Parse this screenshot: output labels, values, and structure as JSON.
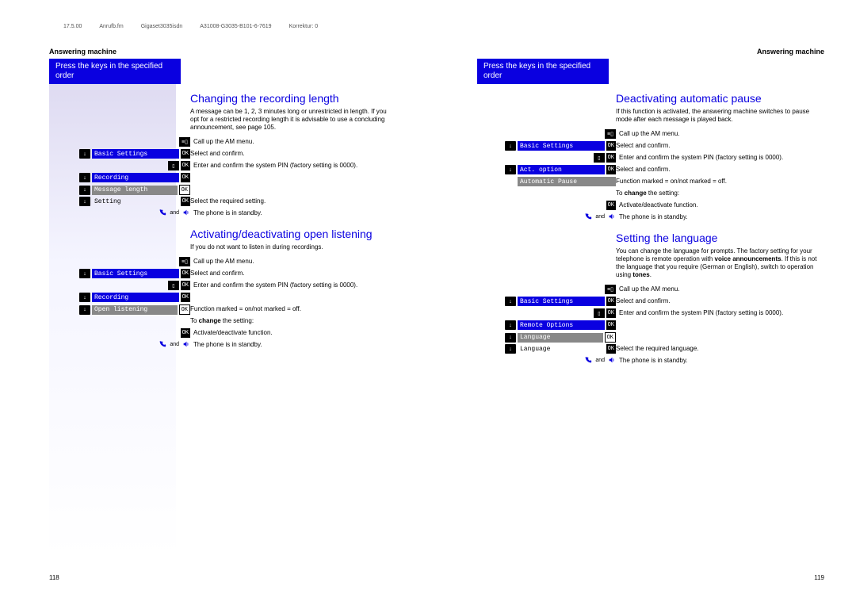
{
  "header": {
    "date": "17.5.00",
    "file": "Anrufb.fm",
    "product": "Gigaset3035isdn",
    "partno": "A31008-G3035-B101-6-7619",
    "korr": "Korrektur: 0"
  },
  "section_title": "Answering machine",
  "blue_bar": "Press the keys in the specified order",
  "left": {
    "h2a": "Changing the recording length",
    "intro_a": "A message can be 1, 2, 3 minutes long or unrestricted in length. If you opt for a restricted recording length it is advisable to use a concluding announcement, see page 105.",
    "rows_a": [
      {
        "k": "menuicon",
        "d": "Call up the AM menu."
      },
      {
        "k": "down",
        "pill": "Basic Settings",
        "ok": "OK",
        "d": "Select and confirm."
      },
      {
        "k": "pin",
        "ok": "OK",
        "d": "Enter and confirm the system PIN (factory setting is 0000)."
      },
      {
        "k": "down",
        "pill": "Recording",
        "ok": "OK",
        "d": ""
      },
      {
        "k": "down",
        "pillg": "Message length",
        "okw": "OK",
        "d": ""
      },
      {
        "k": "down",
        "plain": "Setting",
        "ok": "OK",
        "d": "Select the required setting."
      },
      {
        "k": "handset",
        "d": "The phone is in standby."
      }
    ],
    "h2b": "Activating/deactivating open listening",
    "intro_b": "If you do not want to listen in during recordings.",
    "rows_b": [
      {
        "k": "menuicon",
        "d": "Call up the AM menu."
      },
      {
        "k": "down",
        "pill": "Basic Settings",
        "ok": "OK",
        "d": "Select and confirm."
      },
      {
        "k": "pin",
        "ok": "OK",
        "d": "Enter and confirm the system PIN (factory setting is 0000)."
      },
      {
        "k": "down",
        "pill": "Recording",
        "ok": "OK",
        "d": ""
      },
      {
        "k": "down",
        "pillg": "Open listening",
        "okw": "",
        "d": "Function marked = on/not marked = off."
      },
      {
        "k": "",
        "d_html": "To <b>change</b> the setting:"
      },
      {
        "k": "okonly",
        "ok": "OK",
        "d": "Activate/deactivate function."
      },
      {
        "k": "handset",
        "d": "The phone is in standby."
      }
    ],
    "pagenum": "118"
  },
  "right": {
    "h2a": "Deactivating automatic pause",
    "intro_a": "If this function is activated, the answering machine switches to pause mode after each message is played back.",
    "rows_a": [
      {
        "k": "menuicon",
        "d": "Call up the AM menu."
      },
      {
        "k": "down",
        "pill": "Basic Settings",
        "ok": "OK",
        "d": "Select and confirm."
      },
      {
        "k": "pin",
        "ok": "OK",
        "d": "Enter and confirm the system PIN (factory setting is 0000)."
      },
      {
        "k": "down",
        "pill": "Act. option",
        "ok": "OK",
        "d": "Select and confirm."
      },
      {
        "k": "",
        "pillg": "Automatic Pause",
        "d": "Function marked = on/not marked = off."
      },
      {
        "k": "",
        "d_html": "To <b>change</b> the setting:"
      },
      {
        "k": "okonly",
        "ok": "OK",
        "d": "Activate/deactivate function."
      },
      {
        "k": "handset",
        "d": "The phone is in standby."
      }
    ],
    "h2b": "Setting the language",
    "intro_b_html": "You can change the language for prompts. The factory setting for your telephone is remote operation with <b>voice announcements</b>. If this is not the language that you require (German or English), switch to operation using <b>tones</b>.",
    "rows_b": [
      {
        "k": "menuicon",
        "d": "Call up the AM menu."
      },
      {
        "k": "down",
        "pill": "Basic Settings",
        "ok": "OK",
        "d": "Select and confirm."
      },
      {
        "k": "pin",
        "ok": "OK",
        "d": "Enter and confirm the system PIN (factory setting is 0000)."
      },
      {
        "k": "down",
        "pill": "Remote Options",
        "ok": "OK",
        "d": ""
      },
      {
        "k": "down",
        "pillg": "Language",
        "okw": "OK",
        "d": ""
      },
      {
        "k": "down",
        "plain": "Language",
        "ok": "OK",
        "d": "Select the required language."
      },
      {
        "k": "handset",
        "d": "The phone is in standby."
      }
    ],
    "pagenum": "119"
  },
  "icons": {
    "menu": "≡",
    "down": "↓",
    "pin": "▯▯"
  },
  "labels": {
    "and": "and",
    "ok": "OK"
  }
}
